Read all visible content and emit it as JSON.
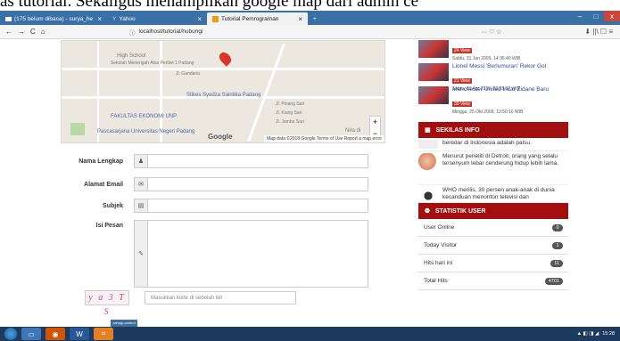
{
  "caption": "as tutorial. Sekaligus menampilkan google map dari admin ce",
  "browser": {
    "tabs": [
      {
        "label": "(175 belum dibaca) - surya_he",
        "icon": "mail-icon"
      },
      {
        "label": "Yahoo",
        "icon": "yahoo-icon"
      },
      {
        "label": "Tutorial Pemrograman",
        "icon": "page-icon"
      }
    ],
    "url": "localhost/tutorial/hubungi",
    "nav": {
      "back": "←",
      "forward": "→",
      "reload": "C",
      "home": "⌂"
    },
    "url_right": "··· ♡ ☆",
    "tools": "⬇ ||\\ ☐ ≡",
    "window_buttons": [
      "–",
      "□",
      "x"
    ]
  },
  "map": {
    "labels": [
      "High School",
      "Sekolah Menengah Atas Pertiwi 1 Padang",
      "Stikes Syedza Saintika Padang",
      "FAKULTAS EKONOMI UNP",
      "Pascasarjana Universitas Negeri Padang",
      "Jl. Gandaria",
      "Jl. Pinang Sari",
      "Jl. Kiang Sari",
      "Jl. Jambu Sari",
      "Nira di"
    ],
    "footer": "Map data ©2018 Google   Terms of Use   Report a map error",
    "logo": "Google"
  },
  "form": {
    "name_label": "Nama Lengkap",
    "email_label": "Alamat Email",
    "subject_label": "Subjek",
    "message_label": "Isi Pesan",
    "captcha_text": "y a 3 T S",
    "captcha_placeholder": "Masukkan kode di sebelah kiri"
  },
  "sidebar": {
    "news": [
      {
        "title": "",
        "badge": "24 View",
        "meta": "Sabtu, 31 Jan 2009, 14:36:40 WIB"
      },
      {
        "title": "Lionel Messi 'Berlumuran' Rekor Gol",
        "badge": "21 View",
        "meta": "Sabtu, 10 Apr 2010, 22:28:32 WIB"
      },
      {
        "title": "Manchester United Incar Zidane Baru",
        "badge": "30 View",
        "meta": "Minggu, 25 Okt 2009, 13:50:16 WIB"
      }
    ],
    "info_header": "SEKILAS INFO",
    "info": [
      "beredar di Indonesia adalah palsu.",
      "Menurut peneliti di Detroit, orang yang selalu tersenyum lebar cenderung hidup lebih lama.",
      "WHO merilis, 30 persen anak-anak di dunia kecanduan menonton televisi dan"
    ],
    "stat_header": "STATISTIK USER",
    "stats": [
      {
        "label": "User Online",
        "value": "0"
      },
      {
        "label": "Today Visitor",
        "value": "1"
      },
      {
        "label": "Hits hari ini",
        "value": "11"
      },
      {
        "label": "Total Hits",
        "value": "4701"
      }
    ]
  },
  "taskbar": {
    "mini_label": "xampp-control",
    "time": "15:28"
  }
}
